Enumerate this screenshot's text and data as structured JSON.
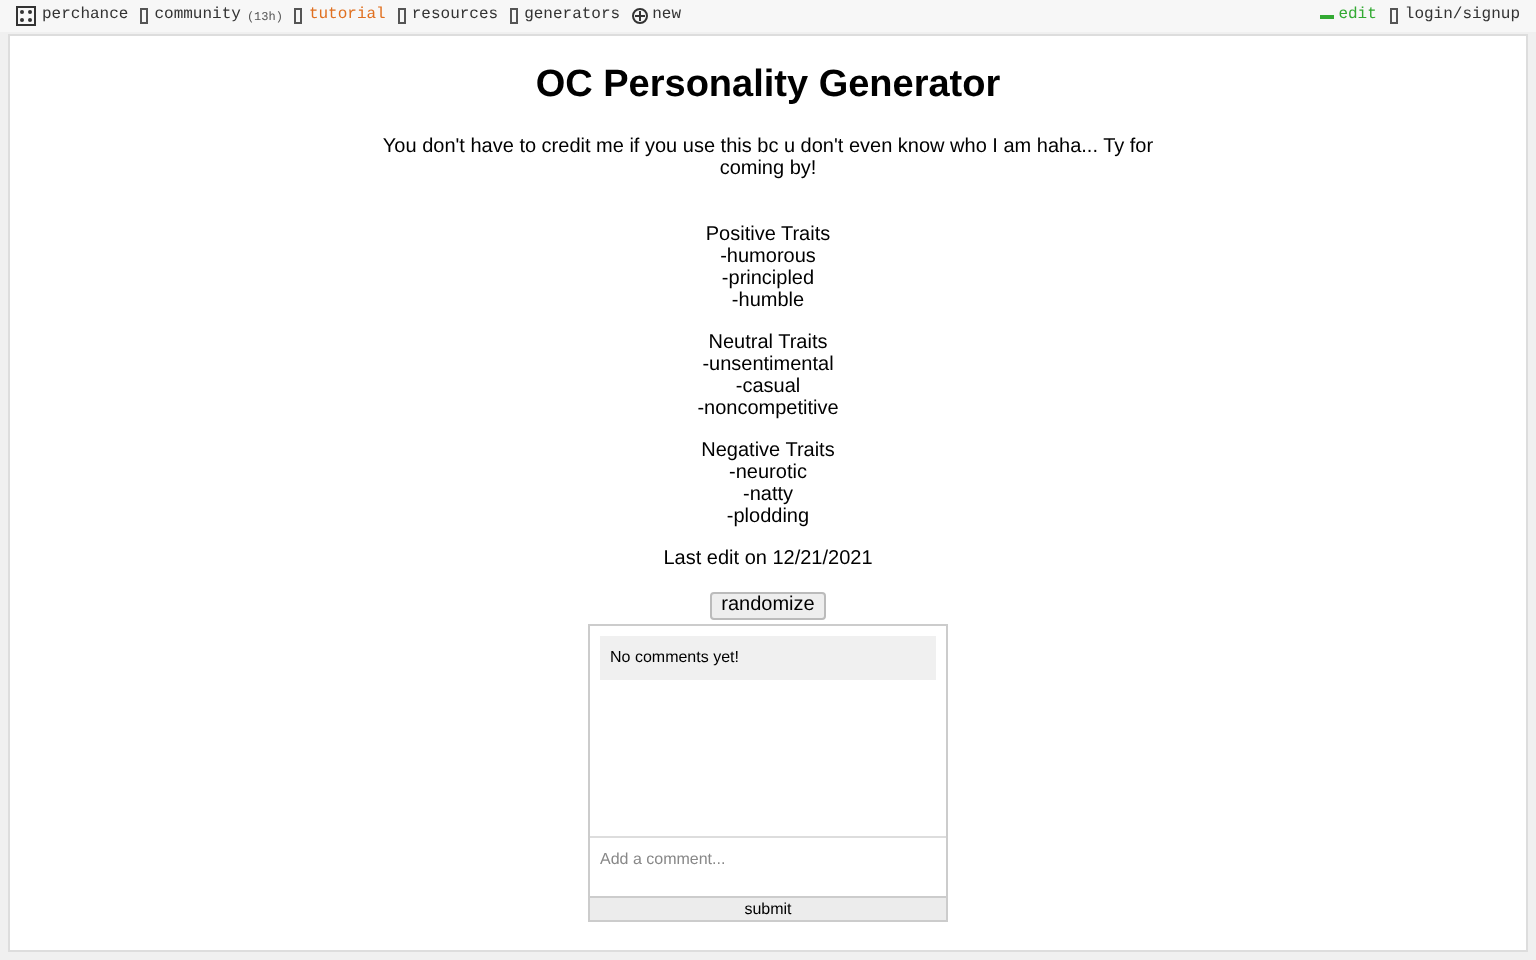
{
  "nav": {
    "left": [
      {
        "kind": "logo",
        "label": "perchance"
      },
      {
        "kind": "link",
        "label": "community",
        "badge": "(13h)",
        "selected": false
      },
      {
        "kind": "link",
        "label": "tutorial",
        "selected": true
      },
      {
        "kind": "link",
        "label": "resources",
        "selected": false
      },
      {
        "kind": "link",
        "label": "generators",
        "selected": false
      },
      {
        "kind": "new",
        "label": "new"
      }
    ],
    "right": [
      {
        "kind": "edit",
        "label": "edit"
      },
      {
        "kind": "link",
        "label": "login/signup"
      }
    ]
  },
  "title": "OC Personality Generator",
  "description": "You don't have to credit me if you use this bc u don't even know who I am haha... Ty for coming by!",
  "groups": [
    {
      "heading": "Positive Traits",
      "items": [
        "-humorous",
        "-principled",
        "-humble"
      ]
    },
    {
      "heading": "Neutral Traits",
      "items": [
        "-unsentimental",
        "-casual",
        "-noncompetitive"
      ]
    },
    {
      "heading": "Negative Traits",
      "items": [
        "-neurotic",
        "-natty",
        "-plodding"
      ]
    }
  ],
  "last_edit": "Last edit on 12/21/2021",
  "randomize_button": "randomize",
  "comments": {
    "empty_message": "No comments yet!",
    "placeholder": "Add a comment...",
    "submit": "submit"
  }
}
